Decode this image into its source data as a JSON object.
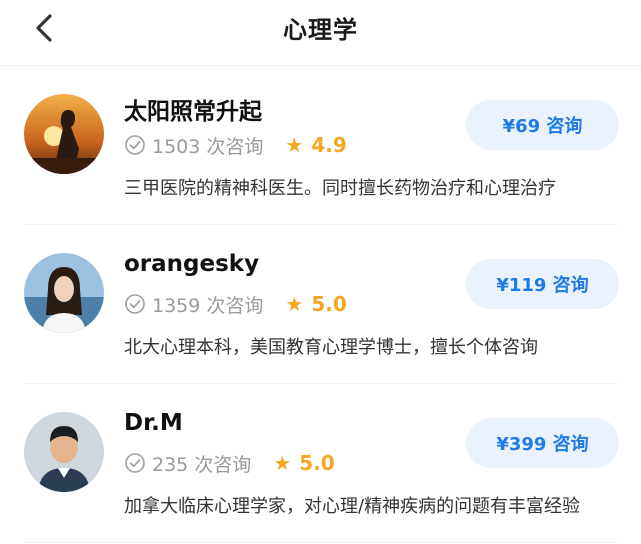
{
  "header": {
    "title": "心理学"
  },
  "consultants": [
    {
      "name": "太阳照常升起",
      "count_text": "1503 次咨询",
      "rating": "4.9",
      "description": "三甲医院的精神科医生。同时擅长药物治疗和心理治疗",
      "button_label": "¥69 咨询",
      "avatar_icon": "sunset-silhouette-avatar"
    },
    {
      "name": "orangesky",
      "count_text": "1359 次咨询",
      "rating": "5.0",
      "description": "北大心理本科，美国教育心理学博士，擅长个体咨询",
      "button_label": "¥119 咨询",
      "avatar_icon": "woman-portrait-avatar"
    },
    {
      "name": "Dr.M",
      "count_text": "235 次咨询",
      "rating": "5.0",
      "description": "加拿大临床心理学家，对心理/精神疾病的问题有丰富经验",
      "button_label": "¥399 咨询",
      "avatar_icon": "man-portrait-avatar"
    }
  ],
  "colors": {
    "accent": "#1f7be6",
    "button_bg": "#e9f2fd",
    "star": "#f5a623",
    "muted": "#9a9a9a"
  }
}
